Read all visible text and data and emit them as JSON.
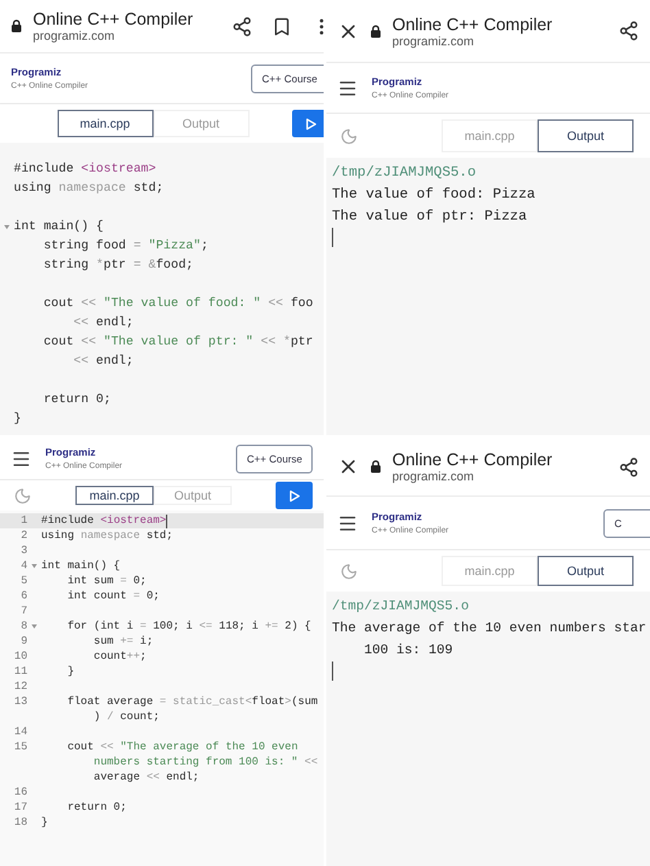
{
  "panels": [
    {
      "kind": "editor",
      "browser_bar": {
        "title": "Online C++ Compiler",
        "domain": "programiz.com",
        "close_button": false,
        "bookmark_button": true,
        "more_button": true
      },
      "header": {
        "menu_button": false,
        "brand": "Programiz",
        "subtitle": "C++ Online Compiler",
        "course_button": {
          "label": "C++ Course"
        }
      },
      "toolbar": {
        "theme_toggle": false,
        "run_button": true,
        "tabs": [
          {
            "label": "main.cpp",
            "selected": true
          },
          {
            "label": "Output",
            "selected": false
          }
        ]
      },
      "editor": {
        "lines": [
          {
            "active": false,
            "fold": false,
            "seg": [
              {
                "kind": "plain",
                "text": "#include "
              },
              {
                "kind": "inc",
                "text": "<iostream>"
              }
            ]
          },
          {
            "active": false,
            "fold": false,
            "seg": [
              {
                "kind": "plain",
                "text": "using "
              },
              {
                "kind": "muted",
                "text": "namespace "
              },
              {
                "kind": "plain",
                "text": "std;"
              }
            ]
          },
          {
            "active": false,
            "fold": false
          },
          {
            "active": false,
            "fold": true,
            "seg": [
              {
                "kind": "plain",
                "text": "int main() {"
              }
            ]
          },
          {
            "active": false,
            "fold": false,
            "seg": [
              {
                "kind": "plain",
                "text": "    string food "
              },
              {
                "kind": "muted",
                "text": "= "
              },
              {
                "kind": "str",
                "text": "\"Pizza\""
              },
              {
                "kind": "plain",
                "text": ";"
              }
            ]
          },
          {
            "active": false,
            "fold": false,
            "seg": [
              {
                "kind": "plain",
                "text": "    string "
              },
              {
                "kind": "muted",
                "text": "*"
              },
              {
                "kind": "plain",
                "text": "ptr "
              },
              {
                "kind": "muted",
                "text": "= &"
              },
              {
                "kind": "plain",
                "text": "food;"
              }
            ]
          },
          {
            "active": false,
            "fold": false
          },
          {
            "active": false,
            "fold": false,
            "seg": [
              {
                "kind": "plain",
                "text": "    cout "
              },
              {
                "kind": "muted",
                "text": "<< "
              },
              {
                "kind": "str",
                "text": "\"The value of food: \" "
              },
              {
                "kind": "muted",
                "text": "<< "
              },
              {
                "kind": "plain",
                "text": "foo"
              }
            ]
          },
          {
            "active": false,
            "fold": false,
            "seg": [
              {
                "kind": "muted",
                "text": "        << "
              },
              {
                "kind": "plain",
                "text": "endl;"
              }
            ]
          },
          {
            "active": false,
            "fold": false,
            "seg": [
              {
                "kind": "plain",
                "text": "    cout "
              },
              {
                "kind": "muted",
                "text": "<< "
              },
              {
                "kind": "str",
                "text": "\"The value of ptr: \" "
              },
              {
                "kind": "muted",
                "text": "<< *"
              },
              {
                "kind": "plain",
                "text": "ptr"
              }
            ]
          },
          {
            "active": false,
            "fold": false,
            "seg": [
              {
                "kind": "muted",
                "text": "        << "
              },
              {
                "kind": "plain",
                "text": "endl;"
              }
            ]
          },
          {
            "active": false,
            "fold": false
          },
          {
            "active": false,
            "fold": false,
            "seg": [
              {
                "kind": "plain",
                "text": "    return 0;"
              }
            ]
          },
          {
            "active": false,
            "fold": false,
            "seg": [
              {
                "kind": "plain",
                "text": "}"
              }
            ]
          }
        ]
      }
    },
    {
      "kind": "output",
      "browser_bar": {
        "title": "Online C++ Compiler",
        "domain": "programiz.com",
        "close_button": true,
        "bookmark_button": false,
        "more_button": false
      },
      "header": {
        "menu_button": true,
        "brand": "Programiz",
        "subtitle": "C++ Online Compiler"
      },
      "toolbar": {
        "theme_toggle": true,
        "run_button": false,
        "tabs": [
          {
            "label": "main.cpp",
            "selected": false
          },
          {
            "label": "Output",
            "selected": true
          }
        ]
      },
      "output": {
        "lines": [
          {
            "kind": "path",
            "text": "/tmp/zJIAMJMQS5.o"
          },
          {
            "kind": "text",
            "text": "The value of food: Pizza"
          },
          {
            "kind": "text",
            "text": "The value of ptr: Pizza"
          }
        ]
      }
    },
    {
      "kind": "editor",
      "header": {
        "menu_button": true,
        "brand": "Programiz",
        "subtitle": "C++ Online Compiler",
        "course_button": {
          "label": "C++ Course"
        }
      },
      "toolbar": {
        "theme_toggle": true,
        "run_button": true,
        "tabs": [
          {
            "label": "main.cpp",
            "selected": true
          },
          {
            "label": "Output",
            "selected": false
          }
        ]
      },
      "editor": {
        "lines": [
          {
            "n": "1",
            "active": true,
            "fold": false,
            "seg": [
              {
                "kind": "plain",
                "text": "#include "
              },
              {
                "kind": "inc",
                "text": "<iostream>"
              }
            ]
          },
          {
            "n": "2",
            "active": false,
            "fold": false,
            "seg": [
              {
                "kind": "plain",
                "text": "using "
              },
              {
                "kind": "muted",
                "text": "namespace "
              },
              {
                "kind": "plain",
                "text": "std;"
              }
            ]
          },
          {
            "n": "3",
            "active": false,
            "fold": false
          },
          {
            "n": "4",
            "active": false,
            "fold": true,
            "seg": [
              {
                "kind": "plain",
                "text": "int main() {"
              }
            ]
          },
          {
            "n": "5",
            "active": false,
            "fold": false,
            "seg": [
              {
                "kind": "plain",
                "text": "    int sum "
              },
              {
                "kind": "muted",
                "text": "= "
              },
              {
                "kind": "plain",
                "text": "0;"
              }
            ]
          },
          {
            "n": "6",
            "active": false,
            "fold": false,
            "seg": [
              {
                "kind": "plain",
                "text": "    int count "
              },
              {
                "kind": "muted",
                "text": "= "
              },
              {
                "kind": "plain",
                "text": "0;"
              }
            ]
          },
          {
            "n": "7",
            "active": false,
            "fold": false
          },
          {
            "n": "8",
            "active": false,
            "fold": true,
            "seg": [
              {
                "kind": "plain",
                "text": "    for (int i "
              },
              {
                "kind": "muted",
                "text": "= "
              },
              {
                "kind": "plain",
                "text": "100; i "
              },
              {
                "kind": "muted",
                "text": "<= "
              },
              {
                "kind": "plain",
                "text": "118; i "
              },
              {
                "kind": "muted",
                "text": "+= "
              },
              {
                "kind": "plain",
                "text": "2) {"
              }
            ]
          },
          {
            "n": "9",
            "active": false,
            "fold": false,
            "seg": [
              {
                "kind": "plain",
                "text": "        sum "
              },
              {
                "kind": "muted",
                "text": "+= "
              },
              {
                "kind": "plain",
                "text": "i;"
              }
            ]
          },
          {
            "n": "10",
            "active": false,
            "fold": false,
            "seg": [
              {
                "kind": "plain",
                "text": "        count"
              },
              {
                "kind": "muted",
                "text": "++"
              },
              {
                "kind": "plain",
                "text": ";"
              }
            ]
          },
          {
            "n": "11",
            "active": false,
            "fold": false,
            "seg": [
              {
                "kind": "plain",
                "text": "    }"
              }
            ]
          },
          {
            "n": "12",
            "active": false,
            "fold": false
          },
          {
            "n": "13",
            "active": false,
            "fold": false,
            "seg": [
              {
                "kind": "plain",
                "text": "    float average "
              },
              {
                "kind": "muted",
                "text": "= static_cast<"
              },
              {
                "kind": "plain",
                "text": "float"
              },
              {
                "kind": "muted",
                "text": ">"
              },
              {
                "kind": "plain",
                "text": "(sum"
              }
            ]
          },
          {
            "active": false,
            "fold": false,
            "seg": [
              {
                "kind": "plain",
                "text": "        ) "
              },
              {
                "kind": "muted",
                "text": "/ "
              },
              {
                "kind": "plain",
                "text": "count;"
              }
            ]
          },
          {
            "n": "14",
            "active": false,
            "fold": false
          },
          {
            "n": "15",
            "active": false,
            "fold": false,
            "seg": [
              {
                "kind": "plain",
                "text": "    cout "
              },
              {
                "kind": "muted",
                "text": "<< "
              },
              {
                "kind": "str",
                "text": "\"The average of the 10 even"
              }
            ]
          },
          {
            "active": false,
            "fold": false,
            "seg": [
              {
                "kind": "str",
                "text": "        numbers starting from 100 is: \" "
              },
              {
                "kind": "muted",
                "text": "<<"
              }
            ]
          },
          {
            "active": false,
            "fold": false,
            "seg": [
              {
                "kind": "plain",
                "text": "        average "
              },
              {
                "kind": "muted",
                "text": "<< "
              },
              {
                "kind": "plain",
                "text": "endl;"
              }
            ]
          },
          {
            "n": "16",
            "active": false,
            "fold": false
          },
          {
            "n": "17",
            "active": false,
            "fold": false,
            "seg": [
              {
                "kind": "plain",
                "text": "    return 0;"
              }
            ]
          },
          {
            "n": "18",
            "active": false,
            "fold": false,
            "seg": [
              {
                "kind": "plain",
                "text": "}"
              }
            ]
          }
        ]
      }
    },
    {
      "kind": "output",
      "browser_bar": {
        "title": "Online C++ Compiler",
        "domain": "programiz.com",
        "close_button": true,
        "bookmark_button": false,
        "more_button": false
      },
      "header": {
        "menu_button": true,
        "brand": "Programiz",
        "subtitle": "C++ Online Compiler",
        "course_button": {
          "label": "C"
        }
      },
      "toolbar": {
        "theme_toggle": true,
        "run_button": false,
        "tabs": [
          {
            "label": "main.cpp",
            "selected": false
          },
          {
            "label": "Output",
            "selected": true
          }
        ]
      },
      "output": {
        "lines": [
          {
            "kind": "path",
            "text": "/tmp/zJIAMJMQS5.o"
          },
          {
            "kind": "text",
            "text": "The average of the 10 even numbers star"
          },
          {
            "kind": "text",
            "text": "    100 is: 109"
          }
        ]
      }
    }
  ]
}
